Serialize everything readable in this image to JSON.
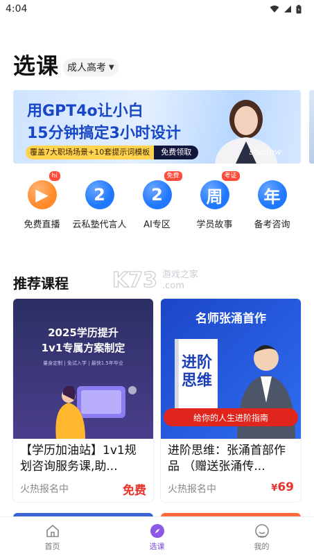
{
  "status_bar": {
    "time": "4:04"
  },
  "header": {
    "title": "选课",
    "category": "成人高考"
  },
  "banner": {
    "line1": "用GPT4o让小白",
    "line2": "15分钟搞定3小时设计",
    "pill_text": "覆盖7大职场场景+10套提示词模板",
    "pill_button": "免费领取",
    "signature": "shadow"
  },
  "quick_nav": [
    {
      "label": "免费直播",
      "glyph": "▶",
      "badge": "hi",
      "color": "#ff8b2c"
    },
    {
      "label": "云私塾代言人",
      "glyph": "2",
      "badge": "",
      "color": "#1f78ff"
    },
    {
      "label": "AI专区",
      "glyph": "2",
      "badge": "免费",
      "color": "#1f78ff"
    },
    {
      "label": "学员故事",
      "glyph": "周",
      "badge": "考证",
      "color": "#1f78ff"
    },
    {
      "label": "备考咨询",
      "glyph": "年",
      "badge": "",
      "color": "#1f78ff"
    }
  ],
  "section": {
    "title": "推荐课程"
  },
  "watermark": {
    "logo": "K73",
    "text": "游戏之家",
    "domain": ".com"
  },
  "courses": [
    {
      "image_line1": "2025学历提升",
      "image_line2": "1v1专属方案制定",
      "image_line3": "量身定制 | 免试入学 | 最快1.5年毕业",
      "title": "【学历加油站】1v1规划咨询服务课,助...",
      "meta": "火热报名中",
      "price": "免费"
    },
    {
      "image_line1": "名师张涌首作",
      "image_book": "进阶思维",
      "image_banner": "给你的人生进阶指南",
      "title": "进阶思维：张涌首部作品 （赠送张涌传...",
      "meta": "火热报名中",
      "price_currency": "¥",
      "price": "69"
    }
  ],
  "bottom_nav": [
    {
      "label": "首页",
      "active": false
    },
    {
      "label": "选课",
      "active": true
    },
    {
      "label": "我的",
      "active": false
    }
  ]
}
